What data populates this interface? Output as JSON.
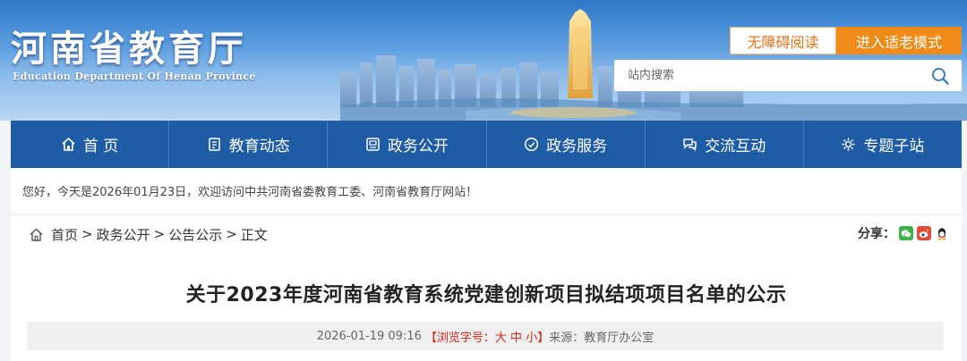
{
  "site": {
    "title": "河南省教育厅",
    "subtitle": "Education Department Of Henan Province"
  },
  "top_buttons": {
    "accessibility": "无障碍阅读",
    "elder_mode": "进入适老模式"
  },
  "search": {
    "placeholder": "站内搜索"
  },
  "nav": {
    "items": [
      {
        "label": "首 页",
        "icon": "home-icon"
      },
      {
        "label": "教育动态",
        "icon": "news-icon"
      },
      {
        "label": "政务公开",
        "icon": "document-icon"
      },
      {
        "label": "政务服务",
        "icon": "service-icon"
      },
      {
        "label": "交流互动",
        "icon": "interaction-icon"
      },
      {
        "label": "专题子站",
        "icon": "topic-icon"
      }
    ]
  },
  "welcome": {
    "text": "您好，今天是2026年01月23日，欢迎访问中共河南省委教育工委、河南省教育厅网站！"
  },
  "breadcrumb": {
    "items": [
      "首页",
      "政务公开",
      "公告公示",
      "正文"
    ],
    "separator": ">"
  },
  "share": {
    "label": "分享：",
    "icons": [
      "wechat-icon",
      "weibo-icon",
      "qq-icon"
    ]
  },
  "article": {
    "title": "关于2023年度河南省教育系统党建创新项目拟结项项目名单的公示",
    "datetime": "2026-01-19 09:16",
    "font_size_label_open": "【浏览字号：",
    "font_large": "大",
    "font_medium": "中",
    "font_small": "小",
    "font_size_label_close": "】",
    "source_label": "来源：",
    "source": "教育厅办公室"
  },
  "colors": {
    "nav_bg": "#1f5ca6",
    "elder_btn": "#f08a18",
    "accessibility_text": "#e8731a",
    "font_size_red": "#d9261c"
  }
}
